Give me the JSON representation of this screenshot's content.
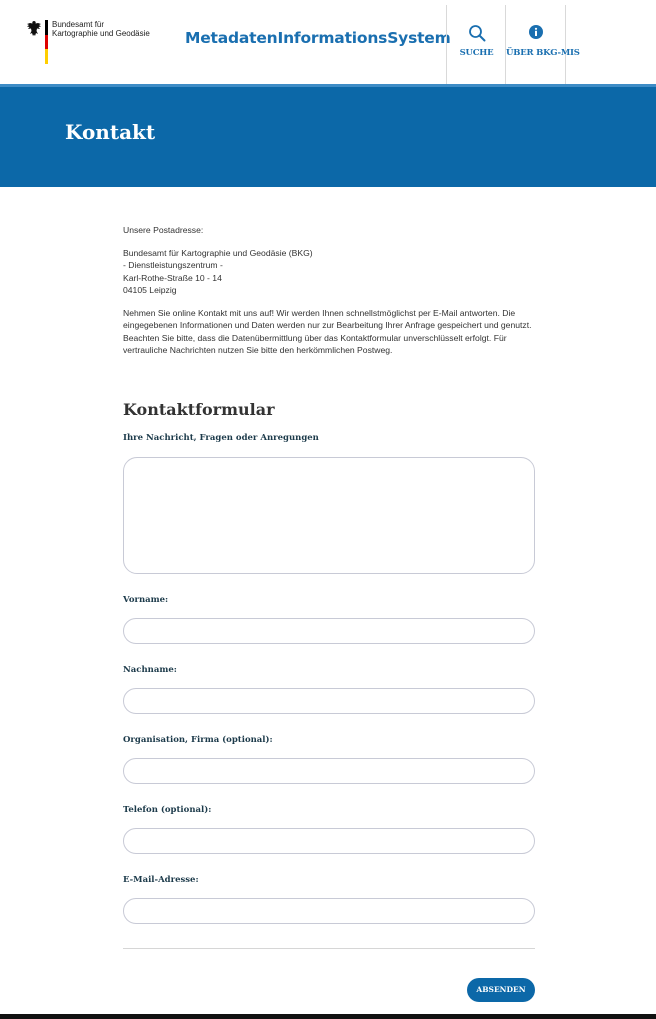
{
  "header": {
    "logo_line1": "Bundesamt für",
    "logo_line2": "Kartographie und Geodäsie",
    "site_title": "MetadatenInformationsSystem",
    "nav": {
      "search_label": "SUCHE",
      "about_label": "ÜBER BKG-MIS"
    },
    "flag_colors": [
      "#000000",
      "#dd0000",
      "#ffce00"
    ]
  },
  "banner": {
    "title": "Kontakt"
  },
  "address": {
    "heading": "Unsere Postadresse:",
    "line1": "Bundesamt für Kartographie und Geodäsie (BKG)",
    "line2": "- Dienstleistungszentrum -",
    "line3": "Karl-Rothe-Straße 10 - 14",
    "line4": "04105 Leipzig"
  },
  "intro_text": "Nehmen Sie online Kontakt mit uns auf! Wir werden Ihnen schnellstmöglichst per E-Mail antworten. Die eingegebenen Informationen und Daten werden nur zur Bearbeitung Ihrer Anfrage gespeichert und genutzt. Beachten Sie bitte, dass die Datenübermittlung über das Kontaktformular unverschlüsselt erfolgt. Für vertrauliche Nachrichten nutzen Sie bitte den herkömmlichen Postweg.",
  "form": {
    "title": "Kontaktformular",
    "message_label": "Ihre Nachricht, Fragen oder Anregungen",
    "message_value": "",
    "firstname_label": "Vorname:",
    "firstname_value": "",
    "lastname_label": "Nachname:",
    "lastname_value": "",
    "org_label": "Organisation, Firma (optional):",
    "org_value": "",
    "phone_label": "Telefon (optional):",
    "phone_value": "",
    "email_label": "E-Mail-Adresse:",
    "email_value": "",
    "submit_label": "ABSENDEN"
  },
  "colors": {
    "brand_blue": "#0c68a8",
    "title_blue": "#1a6fb0"
  }
}
